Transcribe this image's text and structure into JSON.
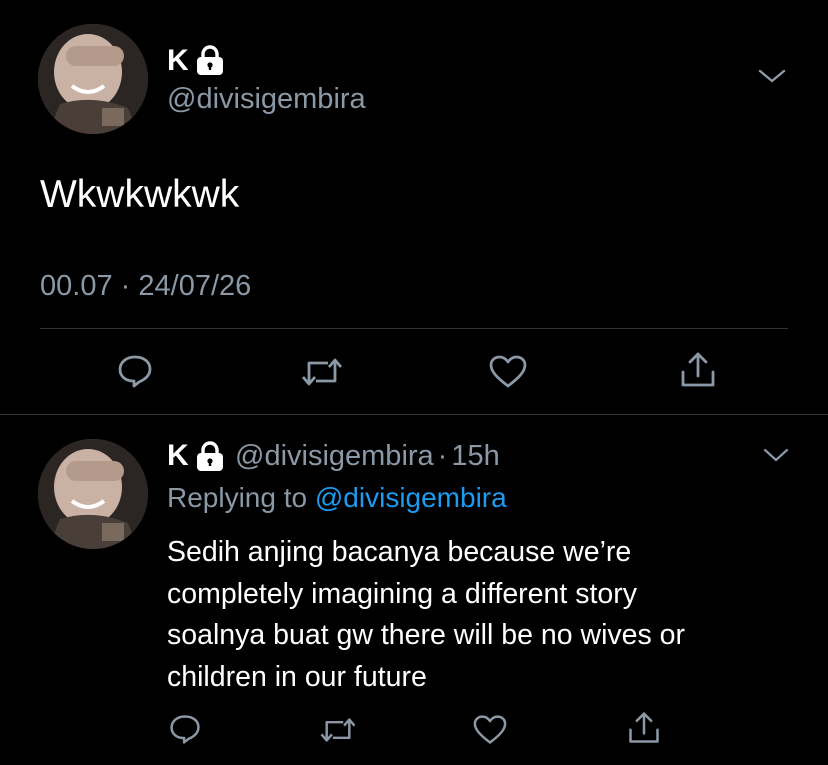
{
  "main_tweet": {
    "author_name": "K",
    "handle": "@divisigembira",
    "text": "Wkwkwkwk",
    "time": "00.07",
    "separator": "·",
    "date": "24/07/26"
  },
  "reply_tweet": {
    "author_name": "K",
    "handle": "@divisigembira",
    "separator": "·",
    "age": "15h",
    "replying_prefix": "Replying to",
    "replying_handle": "@divisigembira",
    "text_lines": [
      "Sedih anjing bacanya because we’re",
      "completely imagining a different story",
      "soalnya buat gw there will be no wives or",
      "children in our future"
    ]
  },
  "icons": {
    "reply": "reply-icon",
    "retweet": "retweet-icon",
    "like": "like-icon",
    "share": "share-icon",
    "lock": "lock-icon",
    "chevron": "chevron-down-icon"
  },
  "colors": {
    "background": "#000000",
    "text": "#ffffff",
    "muted": "#8b98a5",
    "link": "#1d9bf0",
    "divider": "#2f3336"
  }
}
